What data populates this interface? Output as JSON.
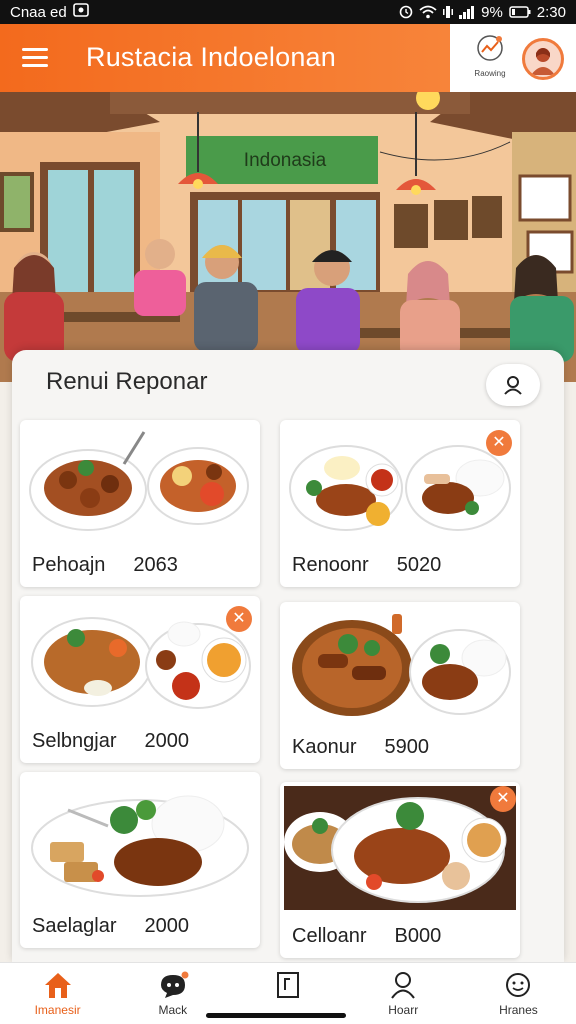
{
  "status_bar": {
    "carrier": "Cnaa ed",
    "battery": "9%",
    "time": "2:30"
  },
  "app_bar": {
    "title": "Rustacia Indoelonan",
    "action_label": "Raowing",
    "brand_color": "#f36a1d"
  },
  "hero": {
    "sign_text": "Indonasia"
  },
  "menu": {
    "title": "Renui Reponar",
    "items": [
      {
        "name": "Pehoajn",
        "price": "2063",
        "has_close": false
      },
      {
        "name": "Renoonr",
        "price": "5020",
        "has_close": true
      },
      {
        "name": "Selbngjar",
        "price": "2000",
        "has_close": true
      },
      {
        "name": "Kaonur",
        "price": "5900",
        "has_close": false
      },
      {
        "name": "Saelaglar",
        "price": "2000",
        "has_close": false
      },
      {
        "name": "Celloanr",
        "price": "B000",
        "has_close": true
      }
    ]
  },
  "bottom_nav": {
    "items": [
      {
        "label": "Imanesir",
        "icon": "home-icon",
        "active": true
      },
      {
        "label": "Mack",
        "icon": "chat-icon",
        "active": false
      },
      {
        "label": "",
        "icon": "document-icon",
        "active": false
      },
      {
        "label": "Hoarr",
        "icon": "person-icon",
        "active": false
      },
      {
        "label": "Hranes",
        "icon": "smiley-icon",
        "active": false
      }
    ]
  }
}
